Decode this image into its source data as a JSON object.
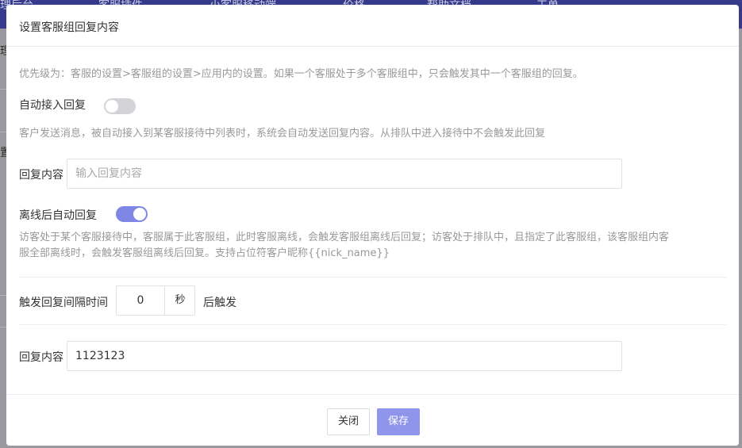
{
  "background": {
    "nav_items": [
      "理后台",
      "客服插件",
      "小客服移动端",
      "价格",
      "帮助文档",
      "工单"
    ],
    "side_fragments": [
      "理",
      "置"
    ]
  },
  "modal": {
    "title": "设置客服组回复内容",
    "priority_hint": "优先级为：客服的设置>客服组的设置>应用内的设置。如果一个客服处于多个客服组中，只会触发其中一个客服组的回复。",
    "auto_accept": {
      "label": "自动接入回复",
      "enabled": false,
      "description": "客户发送消息，被自动接入到某客服接待中列表时，系统会自动发送回复内容。从排队中进入接待中不会触发此回复",
      "content_label": "回复内容",
      "content_value": "",
      "content_placeholder": "输入回复内容"
    },
    "offline_auto": {
      "label": "离线后自动回复",
      "enabled": true,
      "description_line1": "访客处于某个客服接待中，客服属于此客服组，此时客服离线，会触发客服组离线后回复；访客处于排队中，且指定了此客服组，该客服组内客",
      "description_line2": "服全部离线时，会触发客服组离线后回复。支持占位符客户昵称{{nick_name}}"
    },
    "interval": {
      "label": "触发回复间隔时间",
      "value": "0",
      "unit": "秒",
      "suffix": "后触发"
    },
    "offline_content": {
      "label": "回复内容",
      "value": "1123123"
    },
    "buttons": {
      "close": "关闭",
      "save": "保存"
    }
  },
  "colors": {
    "accent": "#7e86e6",
    "primary_button": "#8e95ea"
  }
}
